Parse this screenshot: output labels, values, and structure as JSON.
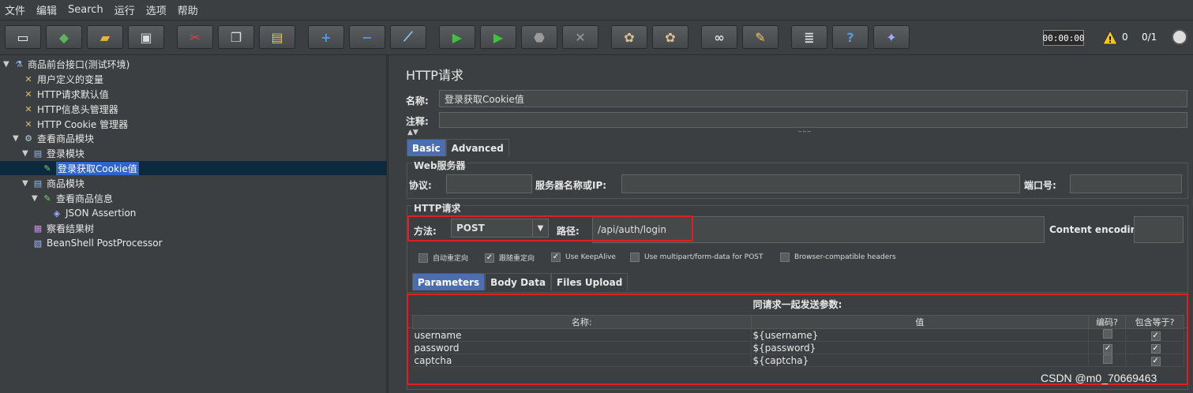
{
  "menu": [
    "文件",
    "编辑",
    "Search",
    "运行",
    "选项",
    "帮助"
  ],
  "toolbar": {
    "buttons": [
      {
        "name": "new-icon",
        "glyph": "▭",
        "color": "#f5f5f5"
      },
      {
        "name": "templates-icon",
        "glyph": "◆",
        "color": "#5fb35f"
      },
      {
        "name": "open-icon",
        "glyph": "▰",
        "color": "#e6b34a"
      },
      {
        "name": "save-icon",
        "glyph": "▣",
        "color": "#dddddd"
      },
      {
        "name": "cut-icon",
        "glyph": "✂",
        "color": "#e04040"
      },
      {
        "name": "copy-icon",
        "glyph": "❐",
        "color": "#dddddd"
      },
      {
        "name": "paste-icon",
        "glyph": "▤",
        "color": "#e6c060"
      },
      {
        "name": "expand-icon",
        "glyph": "+",
        "color": "#4a9be8"
      },
      {
        "name": "collapse-icon",
        "glyph": "−",
        "color": "#4a9be8"
      },
      {
        "name": "toggle-icon",
        "glyph": "⟋",
        "color": "#8ecfff"
      },
      {
        "name": "start-icon",
        "glyph": "▶",
        "color": "#3cc43c"
      },
      {
        "name": "start-no-pause-icon",
        "glyph": "▶",
        "color": "#3cc43c"
      },
      {
        "name": "stop-icon",
        "glyph": "⬣",
        "color": "#9a9a9a"
      },
      {
        "name": "shutdown-icon",
        "glyph": "✕",
        "color": "#9a9a9a"
      },
      {
        "name": "clear-icon",
        "glyph": "✿",
        "color": "#d8c090"
      },
      {
        "name": "clear-all-icon",
        "glyph": "✿",
        "color": "#d8c090"
      },
      {
        "name": "search-icon",
        "glyph": "∞",
        "color": "#dddddd"
      },
      {
        "name": "reset-search-icon",
        "glyph": "✎",
        "color": "#f0d040"
      },
      {
        "name": "function-helper-icon",
        "glyph": "≣",
        "color": "#dddddd"
      },
      {
        "name": "help-icon",
        "glyph": "?",
        "color": "#4a9be8"
      },
      {
        "name": "remote-icon",
        "glyph": "✦",
        "color": "#9ab0ff"
      }
    ],
    "timer": "00:00:00",
    "warnings": "0",
    "threads": "0/1"
  },
  "tree": [
    {
      "label": "商品前台接口(测试环境)",
      "icon": "flask-icon",
      "glyph": "⚗",
      "caret": "▼",
      "indent": 0
    },
    {
      "label": "用户定义的变量",
      "icon": "config-icon",
      "glyph": "✕",
      "caret": "",
      "indent": 1
    },
    {
      "label": "HTTP请求默认值",
      "icon": "config-icon",
      "glyph": "✕",
      "caret": "",
      "indent": 1
    },
    {
      "label": "HTTP信息头管理器",
      "icon": "config-icon",
      "glyph": "✕",
      "caret": "",
      "indent": 1
    },
    {
      "label": "HTTP Cookie 管理器",
      "icon": "config-icon",
      "glyph": "✕",
      "caret": "",
      "indent": 1
    },
    {
      "label": "查看商品模块",
      "icon": "gear-icon",
      "glyph": "⚙",
      "caret": "▼",
      "indent": 1
    },
    {
      "label": "登录模块",
      "icon": "controller-icon",
      "glyph": "▤",
      "caret": "▼",
      "indent": 2
    },
    {
      "label": "登录获取Cookie值",
      "icon": "sampler-icon",
      "glyph": "✎",
      "caret": "",
      "indent": 3,
      "selected": true
    },
    {
      "label": "商品模块",
      "icon": "controller-icon",
      "glyph": "▤",
      "caret": "▼",
      "indent": 2
    },
    {
      "label": "查看商品信息",
      "icon": "sampler-icon",
      "glyph": "✎",
      "caret": "▼",
      "indent": 3
    },
    {
      "label": "JSON Assertion",
      "icon": "assertion-icon",
      "glyph": "◈",
      "caret": "",
      "indent": 4
    },
    {
      "label": "察看结果树",
      "icon": "listener-icon",
      "glyph": "▦",
      "caret": "",
      "indent": 2
    },
    {
      "label": "BeanShell PostProcessor",
      "icon": "postprocessor-icon",
      "glyph": "▧",
      "caret": "",
      "indent": 2
    }
  ],
  "panel": {
    "title": "HTTP请求",
    "name_label": "名称:",
    "name_value": "登录获取Cookie值",
    "comment_label": "注释:",
    "comment_value": "",
    "tabs": [
      "Basic",
      "Advanced"
    ],
    "web_server_title": "Web服务器",
    "protocol_label": "协议:",
    "protocol_value": "",
    "server_label": "服务器名称或IP:",
    "server_value": "",
    "port_label": "端口号:",
    "port_value": "",
    "http_request_title": "HTTP请求",
    "method_label": "方法:",
    "method_value": "POST",
    "path_label": "路径:",
    "path_value": "/api/auth/login",
    "encoding_label": "Content encoding:",
    "encoding_value": "",
    "options": [
      {
        "label": "自动重定向",
        "checked": false
      },
      {
        "label": "跟随重定向",
        "checked": true
      },
      {
        "label": "Use KeepAlive",
        "checked": true
      },
      {
        "label": "Use multipart/form-data for POST",
        "checked": false
      },
      {
        "label": "Browser-compatible headers",
        "checked": false
      }
    ],
    "sub_tabs": [
      "Parameters",
      "Body Data",
      "Files Upload"
    ],
    "params_title": "同请求一起发送参数:",
    "params_headers": [
      "名称:",
      "值",
      "编码?",
      "包含等于?"
    ],
    "params": [
      {
        "name": "username",
        "value": "${username}",
        "encode": false,
        "include_equals": true
      },
      {
        "name": "password",
        "value": "${password}",
        "encode": true,
        "include_equals": true
      },
      {
        "name": "captcha",
        "value": "${captcha}",
        "encode": false,
        "include_equals": true
      }
    ]
  },
  "watermark": "CSDN @m0_70669463",
  "colors": {
    "highlight_red": "#e02020",
    "selection_blue": "#2f65ca",
    "background": "#3c3f41"
  }
}
